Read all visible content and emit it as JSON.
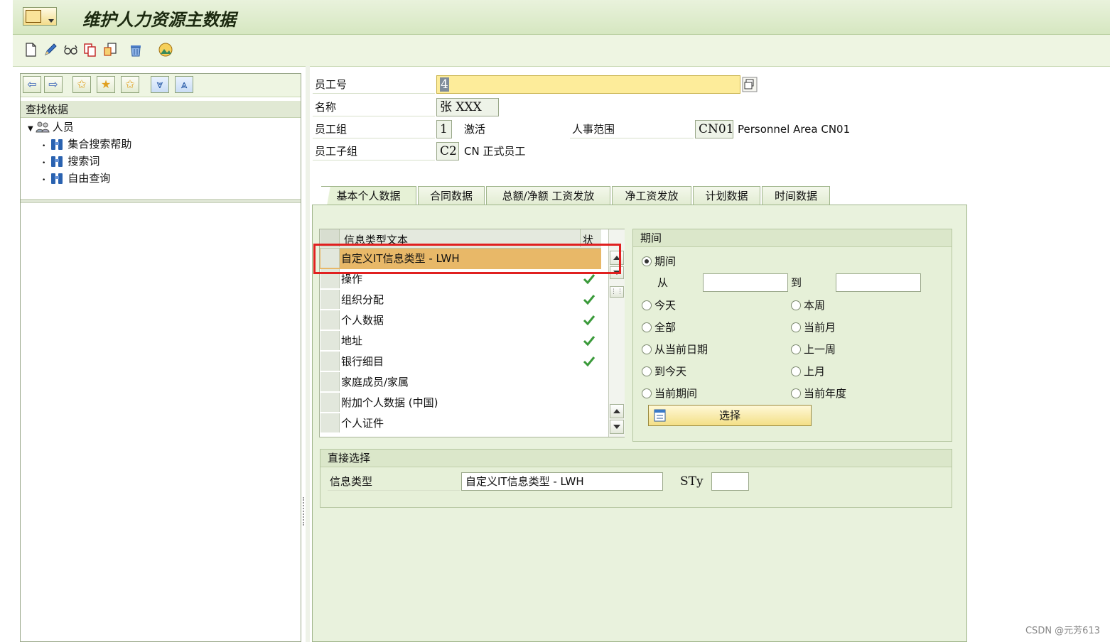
{
  "title": "维护人力资源主数据",
  "nav": {
    "find_by": "查找依据",
    "tree": {
      "root": "人员",
      "children": [
        "集合搜索帮助",
        "搜索词",
        "自由查询"
      ]
    }
  },
  "header_fields": {
    "employee_no_label": "员工号",
    "employee_no_value": "4",
    "name_label": "名称",
    "name_value": "张  XXX",
    "emp_group_label": "员工组",
    "emp_group_code": "1",
    "emp_group_text": "激活",
    "pers_area_label": "人事范围",
    "pers_area_code": "CN01",
    "pers_area_text": "Personnel Area CN01",
    "emp_subgroup_label": "员工子组",
    "emp_subgroup_code": "C2",
    "emp_subgroup_text": "CN 正式员工"
  },
  "tabs": [
    "基本个人数据",
    "合同数据",
    "总额/净额 工资发放",
    "净工资发放",
    "计划数据",
    "时间数据"
  ],
  "infotype_table": {
    "col_text": "信息类型文本",
    "col_status": "状",
    "rows": [
      {
        "text": "自定义IT信息类型 - LWH",
        "check": false,
        "selected": true
      },
      {
        "text": "操作",
        "check": true
      },
      {
        "text": "组织分配",
        "check": true
      },
      {
        "text": "个人数据",
        "check": true
      },
      {
        "text": "地址",
        "check": true
      },
      {
        "text": "银行细目",
        "check": true
      },
      {
        "text": "家庭成员/家属",
        "check": false
      },
      {
        "text": "附加个人数据 (中国)",
        "check": false
      },
      {
        "text": "个人证件",
        "check": false
      }
    ]
  },
  "period": {
    "title": "期间",
    "period_radio": "期间",
    "from_label": "从",
    "to_label": "到",
    "from_value": "",
    "to_value": "",
    "options_left": [
      "今天",
      "全部",
      "从当前日期",
      "到今天",
      "当前期间"
    ],
    "options_right": [
      "本周",
      "当前月",
      "上一周",
      "上月",
      "当前年度"
    ],
    "select_label": "选择"
  },
  "direct": {
    "title": "直接选择",
    "infotype_label": "信息类型",
    "infotype_value": "自定义IT信息类型 - LWH",
    "sty_label": "STy",
    "sty_value": ""
  },
  "watermark": "CSDN @元芳613",
  "colors": {
    "selected_row": "#e8b868",
    "highlight": "#e02020",
    "required_field": "#fdec9a"
  }
}
